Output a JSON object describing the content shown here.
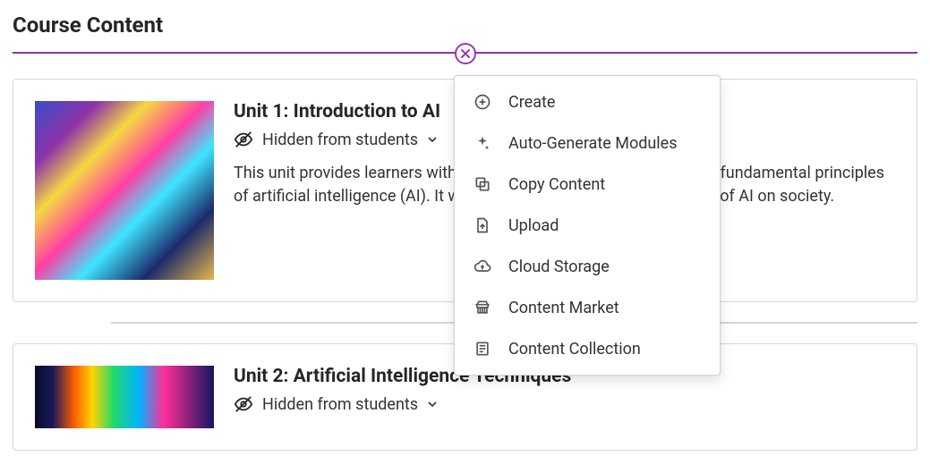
{
  "page": {
    "title": "Course Content"
  },
  "units": [
    {
      "title": "Unit 1: Introduction to AI",
      "visibility": "Hidden from students",
      "description": "This unit provides learners with a foundational understanding of the fundamental principles of artificial intelligence (AI). It will also assess the potential impacts of AI on society."
    },
    {
      "title": "Unit 2: Artificial Intelligence Techniques",
      "visibility": "Hidden from students",
      "description": ""
    }
  ],
  "menu": {
    "items": [
      {
        "label": "Create"
      },
      {
        "label": "Auto-Generate Modules"
      },
      {
        "label": "Copy Content"
      },
      {
        "label": "Upload"
      },
      {
        "label": "Cloud Storage"
      },
      {
        "label": "Content Market"
      },
      {
        "label": "Content Collection"
      }
    ]
  }
}
